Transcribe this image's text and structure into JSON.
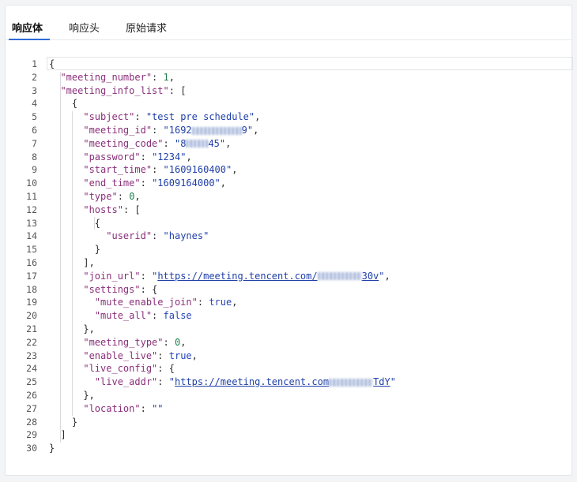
{
  "tabs": [
    {
      "label": "响应体",
      "active": true
    },
    {
      "label": "响应头",
      "active": false
    },
    {
      "label": "原始请求",
      "active": false
    }
  ],
  "accent_color": "#2e6bd8",
  "editor": {
    "lines": [
      {
        "n": "1",
        "text": "{"
      },
      {
        "n": "2",
        "text": "  \"meeting_number\": 1,"
      },
      {
        "n": "3",
        "text": "  \"meeting_info_list\": ["
      },
      {
        "n": "4",
        "text": "    {"
      },
      {
        "n": "5",
        "text": "      \"subject\": \"test pre schedule\","
      },
      {
        "n": "6",
        "text": "      \"meeting_id\": \"1692█████████9\","
      },
      {
        "n": "7",
        "text": "      \"meeting_code\": \"8████45\","
      },
      {
        "n": "8",
        "text": "      \"password\": \"1234\","
      },
      {
        "n": "9",
        "text": "      \"start_time\": \"1609160400\","
      },
      {
        "n": "10",
        "text": "      \"end_time\": \"1609164000\","
      },
      {
        "n": "11",
        "text": "      \"type\": 0,"
      },
      {
        "n": "12",
        "text": "      \"hosts\": ["
      },
      {
        "n": "13",
        "text": "        {"
      },
      {
        "n": "14",
        "text": "          \"userid\": \"haynes\""
      },
      {
        "n": "15",
        "text": "        }"
      },
      {
        "n": "16",
        "text": "      ],"
      },
      {
        "n": "17",
        "text": "      \"join_url\": \"https://meeting.tencent.com/████████30v\","
      },
      {
        "n": "18",
        "text": "      \"settings\": {"
      },
      {
        "n": "19",
        "text": "        \"mute_enable_join\": true,"
      },
      {
        "n": "20",
        "text": "        \"mute_all\": false"
      },
      {
        "n": "21",
        "text": "      },"
      },
      {
        "n": "22",
        "text": "      \"meeting_type\": 0,"
      },
      {
        "n": "23",
        "text": "      \"enable_live\": true,"
      },
      {
        "n": "24",
        "text": "      \"live_config\": {"
      },
      {
        "n": "25",
        "text": "        \"live_addr\": \"https://meeting.tencent.com████████TdY\""
      },
      {
        "n": "26",
        "text": "      },"
      },
      {
        "n": "27",
        "text": "      \"location\": \"\""
      },
      {
        "n": "28",
        "text": "    }"
      },
      {
        "n": "29",
        "text": "  ]"
      },
      {
        "n": "30",
        "text": "}"
      }
    ]
  }
}
